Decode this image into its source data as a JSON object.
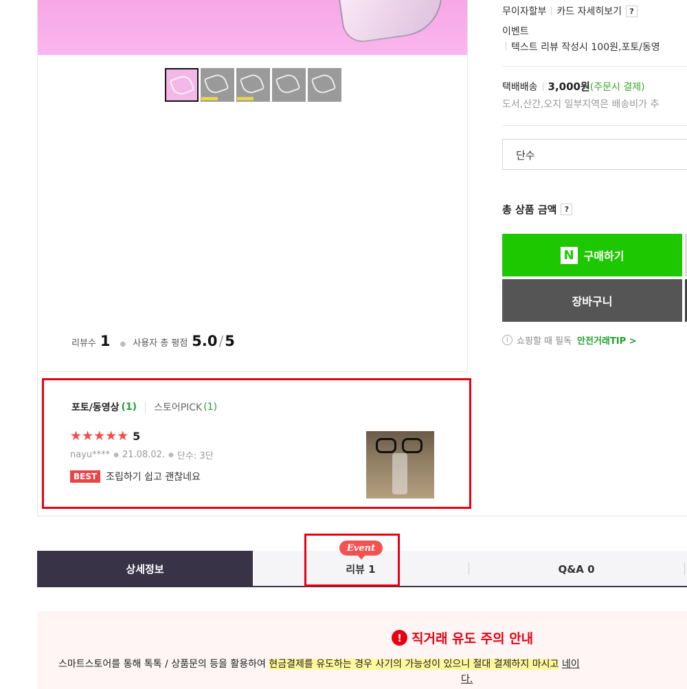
{
  "thumbnails": [
    "thumb-1",
    "thumb-2",
    "thumb-3",
    "thumb-4",
    "thumb-5"
  ],
  "rating_summary": {
    "review_count_label": "리뷰수",
    "review_count": "1",
    "avg_label": "사용자 총 평점",
    "avg_score": "5.0",
    "avg_max": "5"
  },
  "purchase_info": {
    "installment": "무이자할부",
    "card_detail": "카드 자세히보기",
    "help": "?",
    "event_label": "이벤트",
    "event_text": "텍스트 리뷰 작성시 100원,포토/동영",
    "shipping_label": "택배배송",
    "shipping_price": "3,000원",
    "shipping_payment": "(주문시 결제)",
    "shipping_note": "도서,산간,오지 일부지역은 배송비가 추",
    "option_select": "단수",
    "total_label": "총 상품 금액",
    "buy_button": "구매하기",
    "npay_logo": "N",
    "cart_button": "장바구니",
    "tip_icon": "i",
    "tip_text": "쇼핑할 때 필독",
    "tip_link": "안전거래TIP >"
  },
  "reviews": {
    "tab_photo": "포토/동영상",
    "tab_photo_count": "(1)",
    "tab_pick": "스토어PICK",
    "tab_pick_count": "(1)",
    "items": [
      {
        "stars": "★★★★★",
        "score": "5",
        "user": "nayu****",
        "date": "21.08.02.",
        "option": "단수: 3단",
        "badge": "BEST",
        "text": "조립하기 쉽고 괜찮네요"
      }
    ]
  },
  "tabs": {
    "detail": "상세정보",
    "review": "리뷰 1",
    "review_event_badge": "Event",
    "qna": "Q&A 0"
  },
  "notice": {
    "title": "직거래 유도 주의 안내",
    "icon": "!",
    "body_start": "스마트스토어를 통해 톡톡 / 상품문의 등을 활용하여 ",
    "body_highlight": "현금결제를 유도하는 경우 사기의 가능성이 있으니 절대 결제하지 마시고",
    "body_link": "네이",
    "body_end": "다."
  },
  "colors": {
    "buy_green": "#1ec800",
    "cart_gray": "#555555",
    "tab_active": "#393347",
    "highlight_red": "#e60012",
    "star_red": "#f14b4b"
  }
}
